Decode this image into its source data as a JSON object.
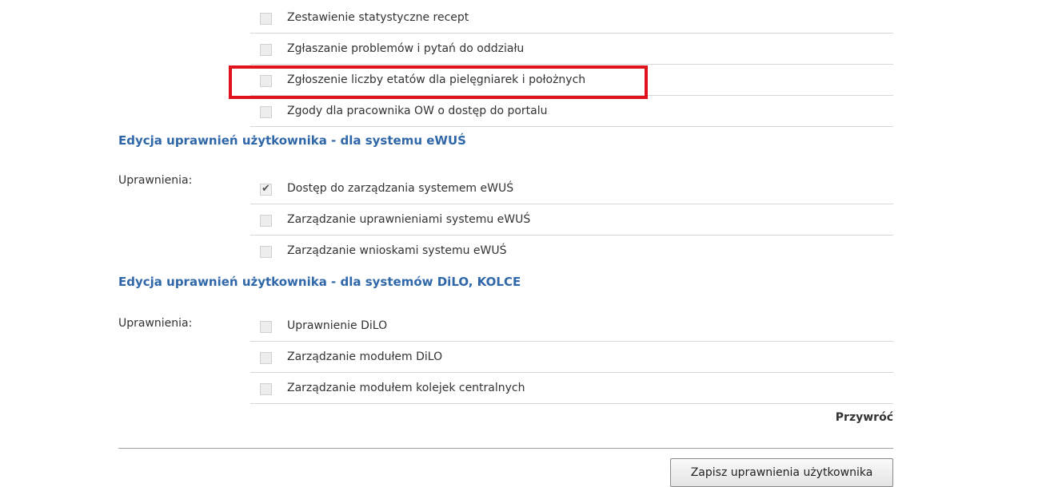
{
  "top_permissions": [
    {
      "label": "Zestawienie statystyczne recept",
      "checked": false
    },
    {
      "label": "Zgłaszanie problemów i pytań do oddziału",
      "checked": false
    },
    {
      "label": "Zgłoszenie liczby etatów dla pielęgniarek i położnych",
      "checked": false,
      "highlighted": true
    },
    {
      "label": "Zgody dla pracownika OW o dostęp do portalu",
      "checked": false
    }
  ],
  "ewus": {
    "title": "Edycja uprawnień użytkownika - dla systemu eWUŚ",
    "field_label": "Uprawnienia:",
    "permissions": [
      {
        "label": "Dostęp do zarządzania systemem eWUŚ",
        "checked": true
      },
      {
        "label": "Zarządzanie uprawnieniami systemu eWUŚ",
        "checked": false
      },
      {
        "label": "Zarządzanie wnioskami systemu eWUŚ",
        "checked": false
      }
    ]
  },
  "dilo": {
    "title": "Edycja uprawnień użytkownika - dla systemów DiLO, KOLCE",
    "field_label": "Uprawnienia:",
    "permissions": [
      {
        "label": "Uprawnienie DiLO",
        "checked": false
      },
      {
        "label": "Zarządzanie modułem DiLO",
        "checked": false
      },
      {
        "label": "Zarządzanie modułem kolejek centralnych",
        "checked": false
      }
    ]
  },
  "actions": {
    "restore_label": "Przywróć",
    "save_label": "Zapisz uprawnienia użytkownika"
  },
  "colors": {
    "section_title": "#2f67a8",
    "highlight": "#e0121c"
  },
  "icons": {
    "checked_mark": "✔"
  }
}
